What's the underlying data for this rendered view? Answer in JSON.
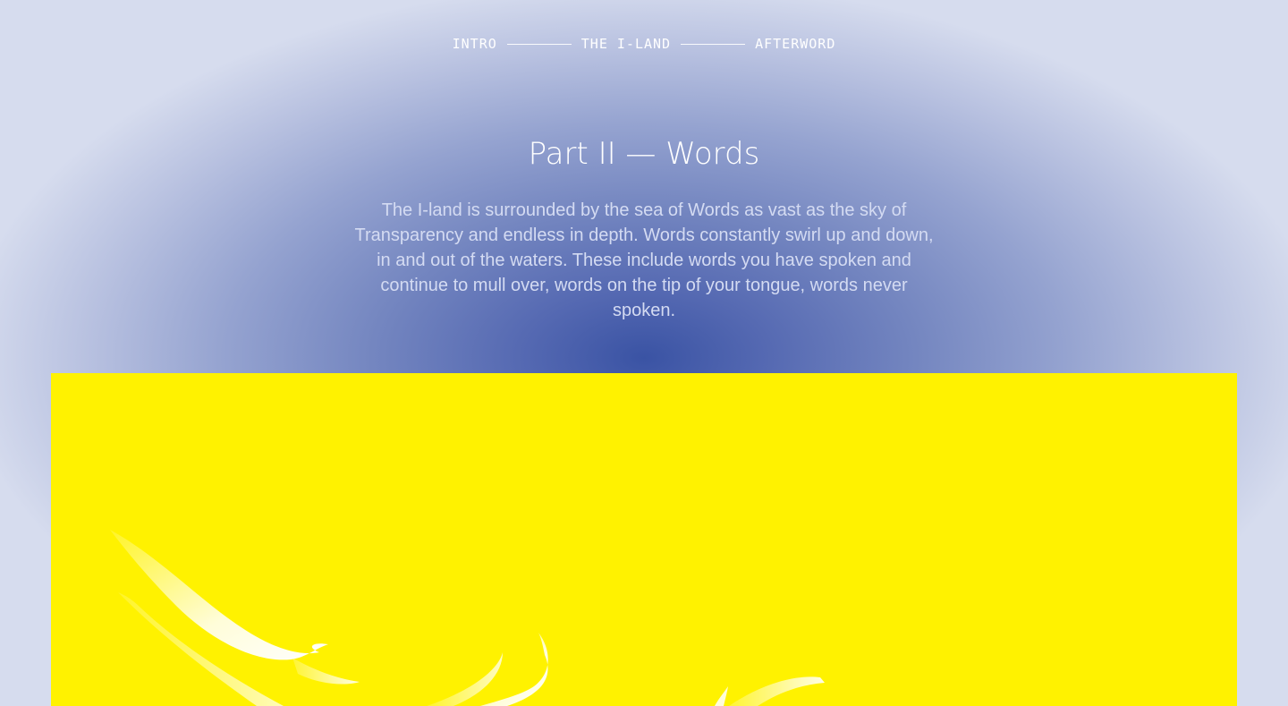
{
  "nav": {
    "items": [
      {
        "label": "INTRO"
      },
      {
        "label": "THE I-LAND"
      },
      {
        "label": "AFTERWORD"
      }
    ]
  },
  "section": {
    "title": "Part II — Words",
    "intro": "The I-land is surrounded by the sea of Words as vast as the sky of Transparency and endless in depth. Words constantly swirl up and down, in and out of the waters. These include words you have spoken and continue to mull over, words on the tip of your tongue, words never spoken."
  },
  "colors": {
    "background_center": "#3a53a4",
    "background_edge": "#d6dcee",
    "panel": "#fff200",
    "text": "#ffffff",
    "intro_text": "#d4dbf2"
  },
  "illustration": {
    "name": "white-wave-swirls"
  }
}
